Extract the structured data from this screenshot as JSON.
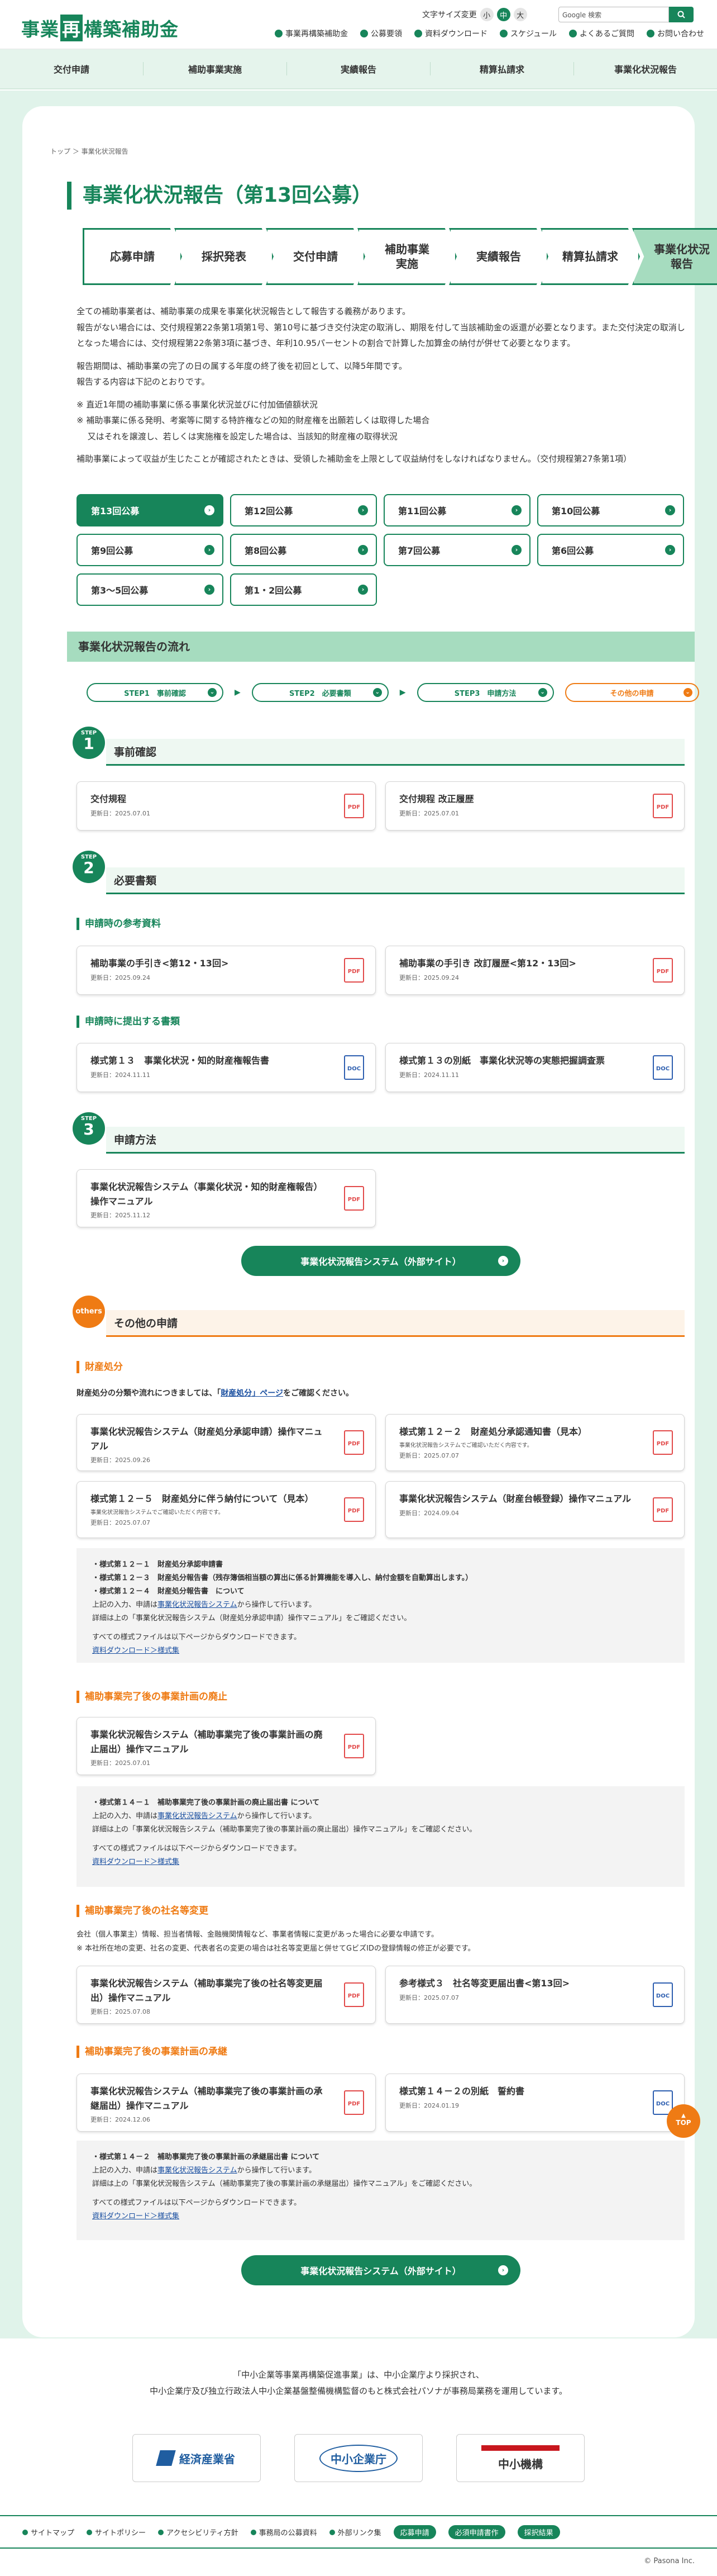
{
  "header": {
    "logo_pre": "事業",
    "logo_box": "再",
    "logo_post": "構築補助金",
    "font_size_label": "文字サイズ変更",
    "font_sizes": [
      "小",
      "中",
      "大"
    ],
    "search_placeholder": "Google 検索",
    "util": [
      "事業再構築補助金",
      "公募要領",
      "資料ダウンロード",
      "スケジュール",
      "よくあるご質問",
      "お問い合わせ"
    ]
  },
  "gnav": [
    "交付申請",
    "補助事業実施",
    "実績報告",
    "精算払請求",
    "事業化状況報告"
  ],
  "breadcrumb": "トップ ＞ 事業化状況報告",
  "title": "事業化状況報告（第13回公募）",
  "flow": [
    "応募申請",
    "採択発表",
    "交付申請",
    "補助事業\n実施",
    "実績報告",
    "精算払請求",
    "事業化状況\n報告"
  ],
  "intro": [
    "全ての補助事業者は、補助事業の成果を事業化状況報告として報告する義務があります。\n報告がない場合には、交付規程第22条第1項第1号、第10号に基づき交付決定の取消し、期限を付して当該補助金の返還が必要となります。また交付決定の取消しとなった場合には、交付規程第22条第3項に基づき、年利10.95パーセントの割合で計算した加算金の納付が併せて必要となります。",
    "報告期間は、補助事業の完了の日の属する年度の終了後を初回として、以降5年間です。\n報告する内容は下記のとおりです。",
    "※ 直近1年間の補助事業に係る事業化状況並びに付加価値額状況\n※ 補助事業に係る発明、考案等に関する特許権などの知的財産権を出願若しくは取得した場合\n　 又はそれを譲渡し、若しくは実施権を設定した場合は、当該知的財産権の取得状況",
    "補助事業によって収益が生じたことが確認されたときは、受領した補助金を上限として収益納付をしなければなりません。（交付規程第27条第1項）"
  ],
  "tabs": [
    "第13回公募",
    "第12回公募",
    "第11回公募",
    "第10回公募",
    "第9回公募",
    "第8回公募",
    "第7回公募",
    "第6回公募",
    "第3〜5回公募",
    "第1・2回公募"
  ],
  "flow_section": "事業化状況報告の流れ",
  "pills": [
    "STEP1　事前確認",
    "STEP2　必要書類",
    "STEP3　申請方法",
    "その他の申請"
  ],
  "step1": {
    "num": "1",
    "step": "STEP",
    "title": "事前確認",
    "docs": [
      {
        "t": "交付規程",
        "d": "更新日：2025.07.01"
      },
      {
        "t": "交付規程 改正履歴",
        "d": "更新日：2025.07.01"
      }
    ]
  },
  "step2": {
    "num": "2",
    "step": "STEP",
    "title": "必要書類",
    "sub1": "申請時の参考資料",
    "docs1": [
      {
        "t": "補助事業の手引き<第12・13回>",
        "d": "更新日：2025.09.24"
      },
      {
        "t": "補助事業の手引き 改訂履歴<第12・13回>",
        "d": "更新日：2025.09.24"
      }
    ],
    "sub2": "申請時に提出する書類",
    "docs2": [
      {
        "t": "様式第１３　事業化状況・知的財産権報告書",
        "d": "更新日：2024.11.11"
      },
      {
        "t": "様式第１３の別紙　事業化状況等の実態把握調査票",
        "d": "更新日：2024.11.11"
      }
    ]
  },
  "step3": {
    "num": "3",
    "step": "STEP",
    "title": "申請方法",
    "doc": {
      "t": "事業化状況報告システム（事業化状況・知的財産権報告）操作マニュアル",
      "d": "更新日：2025.11.12"
    },
    "button": "事業化状況報告システム（外部サイト）"
  },
  "other": {
    "badge": "others",
    "title": "その他の申請",
    "s1": {
      "title": "財産処分",
      "lead_a": "財産処分の分類や流れにつきましては、「",
      "lead_link": "財産処分」ページ",
      "lead_b": "をご確認ください。",
      "docs": [
        {
          "t": "事業化状況報告システム（財産処分承認申請）操作マニュアル",
          "s": "",
          "d": "更新日：2025.09.26"
        },
        {
          "t": "様式第１２－２　財産処分承認通知書（見本）",
          "s": "事業化状況報告システムでご確認いただく内容です。",
          "d": "更新日：2025.07.07"
        },
        {
          "t": "様式第１２－５　財産処分に伴う納付について（見本）",
          "s": "事業化状況報告システムでご確認いただく内容です。",
          "d": "更新日：2025.07.07"
        },
        {
          "t": "事業化状況報告システム（財産台帳登録）操作マニュアル",
          "s": "",
          "d": "更新日：2024.09.04"
        }
      ],
      "box": [
        "・様式第１２－１　財産処分承認申請書",
        "・様式第１２－３　財産処分報告書（残存簿価相当額の算出に係る計算機能を導入し、納付金額を自動算出します。）",
        "・様式第１２－４　財産処分報告書　について",
        "上記の入力、申請は",
        "事業化状況報告システム",
        "から操作して行います。",
        "詳細は上の「事業化状況報告システム（財産処分承認申請）操作マニュアル」をご確認ください。",
        "すべての様式ファイルは以下ページからダウンロードできます。",
        "資料ダウンロード＞様式集"
      ]
    },
    "s2": {
      "title": "補助事業完了後の事業計画の廃止",
      "doc": {
        "t": "事業化状況報告システム（補助事業完了後の事業計画の廃止届出）操作マニュアル",
        "d": "更新日：2025.07.01"
      },
      "box": [
        "・様式第１４－１　補助事業完了後の事業計画の廃止届出書 について",
        "上記の入力、申請は",
        "事業化状況報告システム",
        "から操作して行います。",
        "詳細は上の「事業化状況報告システム（補助事業完了後の事業計画の廃止届出）操作マニュアル」をご確認ください。",
        "すべての様式ファイルは以下ページからダウンロードできます。",
        "資料ダウンロード＞様式集"
      ]
    },
    "s3": {
      "title": "補助事業完了後の社名等変更",
      "lead": "会社（個人事業主）情報、担当者情報、金融機関情報など、事業者情報に変更があった場合に必要な申請です。\n※ 本社所在地の変更、社名の変更、代表者名の変更の場合は社名等変更届と併せてGビズIDの登録情報の修正が必要です。",
      "docs": [
        {
          "t": "事業化状況報告システム（補助事業完了後の社名等変更届出）操作マニュアル",
          "d": "更新日：2025.07.08"
        },
        {
          "t": "参考様式３　社名等変更届出書<第13回>",
          "d": "更新日：2025.07.07"
        }
      ]
    },
    "s4": {
      "title": "補助事業完了後の事業計画の承継",
      "docs": [
        {
          "t": "事業化状況報告システム（補助事業完了後の事業計画の承継届出）操作マニュアル",
          "d": "更新日：2024.12.06"
        },
        {
          "t": "様式第１４－２の別紙　誓約書",
          "d": "更新日：2024.01.19"
        }
      ],
      "box": [
        "・様式第１４－２　補助事業完了後の事業計画の承継届出書 について",
        "上記の入力、申請は",
        "事業化状況報告システム",
        "から操作して行います。",
        "詳細は上の「事業化状況報告システム（補助事業完了後の事業計画の承継届出）操作マニュアル」をご確認ください。",
        "すべての様式ファイルは以下ページからダウンロードできます。",
        "資料ダウンロード＞様式集"
      ],
      "button": "事業化状況報告システム（外部サイト）"
    }
  },
  "top": "TOP",
  "footer": {
    "line1": "「中小企業等事業再構築促進事業」は、中小企業庁より採択され、",
    "line2": "中小企業庁及び独立行政法人中小企業基盤整備機構監督のもと株式会社パソナが事務局業務を運用しています。",
    "logos": [
      "経済産業省",
      "中小企業庁",
      "中小機構"
    ],
    "nav": [
      "サイトマップ",
      "サイトポリシー",
      "アクセシビリティ方針",
      "事務局の公募資料",
      "外部リンク集"
    ],
    "nav_btns": [
      "応募申請",
      "必須申請書作",
      "採択結果"
    ],
    "copy": "© Pasona Inc."
  },
  "colors": {
    "green": "#17855a",
    "light": "#a6dcbf",
    "orange": "#ef7b14"
  }
}
